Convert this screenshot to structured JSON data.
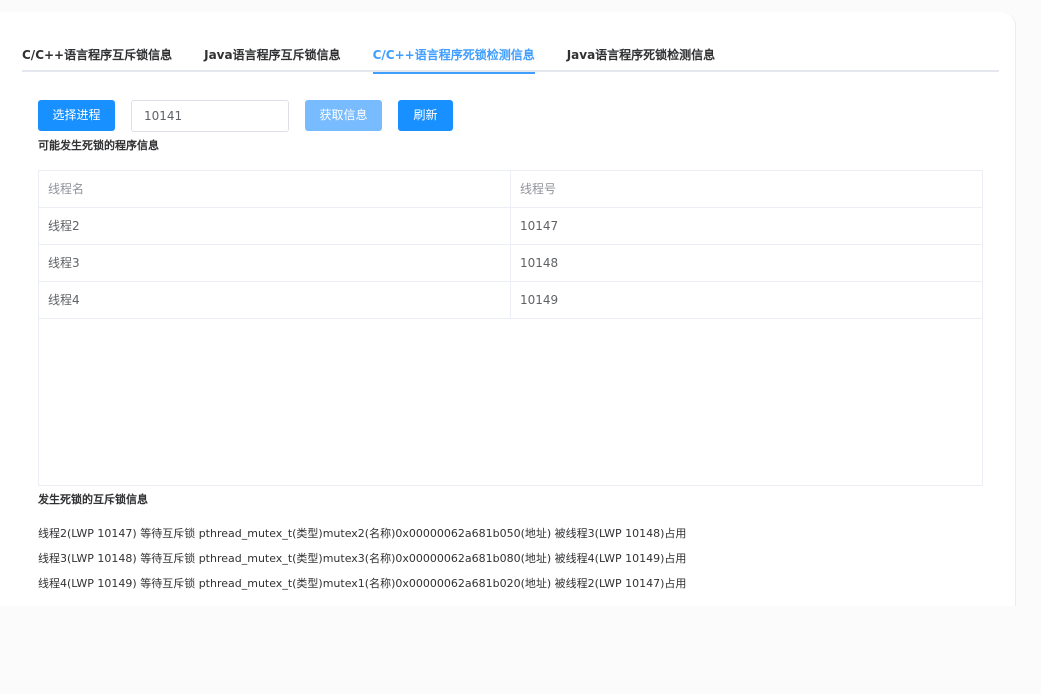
{
  "tabs": [
    {
      "label": "C/C++语言程序互斥锁信息"
    },
    {
      "label": "Java语言程序互斥锁信息"
    },
    {
      "label": "C/C++语言程序死锁检测信息",
      "active": true
    },
    {
      "label": "Java语言程序死锁检测信息"
    }
  ],
  "toolbar": {
    "select_label": "选择进程",
    "pid_value": "10141",
    "fetch_label": "获取信息",
    "refresh_label": "刷新"
  },
  "threads_section": {
    "title": "可能发生死锁的程序信息",
    "columns": [
      "线程名",
      "线程号"
    ],
    "rows": [
      [
        "线程2",
        "10147"
      ],
      [
        "线程3",
        "10148"
      ],
      [
        "线程4",
        "10149"
      ]
    ]
  },
  "mutex_section": {
    "title": "发生死锁的互斥锁信息",
    "lines": [
      "线程2(LWP 10147) 等待互斥锁 pthread_mutex_t(类型)mutex2(名称)0x00000062a681b050(地址) 被线程3(LWP 10148)占用",
      "线程3(LWP 10148) 等待互斥锁 pthread_mutex_t(类型)mutex3(名称)0x00000062a681b080(地址) 被线程4(LWP 10149)占用",
      "线程4(LWP 10149) 等待互斥锁 pthread_mutex_t(类型)mutex1(名称)0x00000062a681b020(地址) 被线程2(LWP 10147)占用"
    ]
  },
  "colors": {
    "primary": "#1890ff",
    "primary_disabled": "#79bbff",
    "tab_active": "#409eff"
  }
}
